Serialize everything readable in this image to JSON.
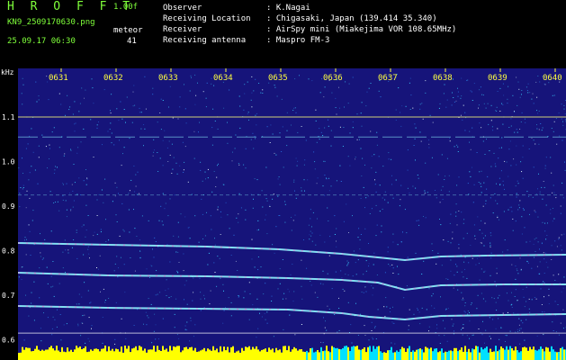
{
  "header": {
    "app_title": "H R O F F T",
    "version": "1.00f",
    "filename": "KN9_2509170630.png",
    "mode": "meteor",
    "datetime": "25.09.17 06:30",
    "count": "41",
    "info": [
      {
        "label": "Observer",
        "value": ": K.Nagai"
      },
      {
        "label": "Receiving Location",
        "value": ": Chigasaki, Japan (139.414 35.340)"
      },
      {
        "label": "Receiver",
        "value": ": AirSpy mini (Miakejima VOR 108.65MHz)"
      },
      {
        "label": "Receiving antenna",
        "value": ": Maspro FM-3"
      }
    ]
  },
  "spectrogram": {
    "y_unit": "kHz",
    "y_ticks": [
      "1.1",
      "1.0",
      "0.9",
      "0.8",
      "0.7",
      "0.6"
    ],
    "time_ticks": [
      "0631",
      "0632",
      "0633",
      "0634",
      "0635",
      "0636",
      "0637",
      "0638",
      "0639",
      "0640"
    ],
    "colors": {
      "background": "#16147a",
      "noise_cyan": "#3ad0ff",
      "trace": "#8ff6ff",
      "reference_line": "#ffff7a",
      "tick_label": "#ffff40",
      "bottom_bar": "#ffff00",
      "bottom_bar_right": "#00e0ff"
    }
  }
}
